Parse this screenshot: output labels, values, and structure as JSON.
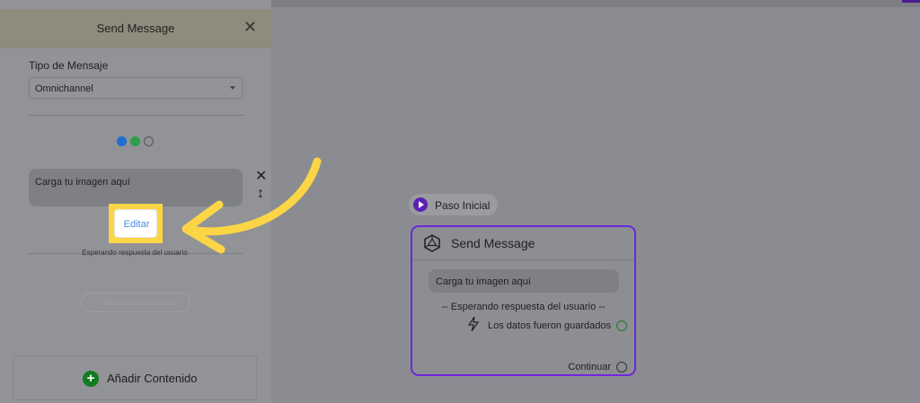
{
  "panel": {
    "title": "Send Message",
    "tipo_label": "Tipo de Mensaje",
    "tipo_value": "Omnichannel",
    "channels": [
      "messenger-icon",
      "whatsapp-icon",
      "sms-icon"
    ],
    "image_placeholder": "Carga tu imagen aquí",
    "edit_label": "Editar",
    "waiting_text": "Esperando respuesta del usuario",
    "ghost_button": "+ Respuestas rápidas",
    "add_content": "Añadir Contenido"
  },
  "canvas": {
    "start_label": "Paso Inicial",
    "node": {
      "title": "Send Message",
      "image_placeholder": "Carga tu imagen aquí",
      "waiting_text": "-- Esperando respuesta del usuario --",
      "saved_text": "Los datos fueron guardados",
      "continue_text": "Continuar"
    }
  },
  "colors": {
    "highlight": "#fbd545",
    "node_border": "#6d28d9",
    "accent": "#5b21b6"
  }
}
